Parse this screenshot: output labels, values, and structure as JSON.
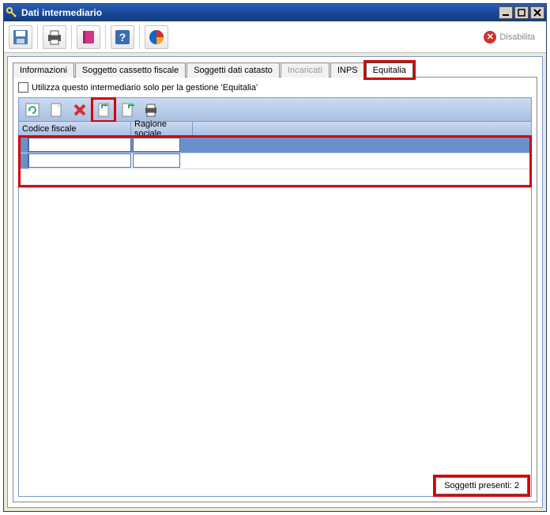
{
  "window": {
    "title": "Dati intermediario"
  },
  "mainToolbar": {
    "disable_label": "Disabilita"
  },
  "tabs": {
    "t0": "Informazioni",
    "t1": "Soggetto cassetto fiscale",
    "t2": "Soggetti dati catasto",
    "t3": "Incaricati",
    "t4": "INPS",
    "t5": "Equitalia"
  },
  "panel": {
    "checkbox_label": "Utilizza questo intermediario solo per la gestione 'Equitalia'"
  },
  "table": {
    "col1": "Codice fiscale",
    "col2": "Ragione sociale"
  },
  "footer": {
    "count_text": "Soggetti presenti: 2"
  }
}
